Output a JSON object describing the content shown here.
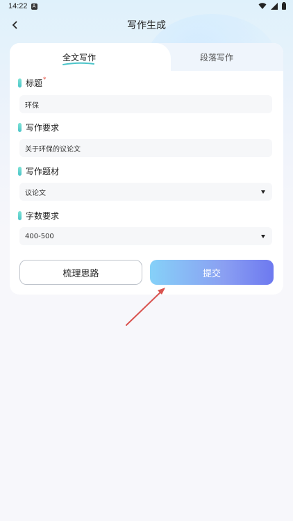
{
  "status": {
    "time": "14:22",
    "badge": "A"
  },
  "header": {
    "title": "写作生成"
  },
  "tabs": [
    {
      "label": "全文写作",
      "active": true
    },
    {
      "label": "段落写作",
      "active": false
    }
  ],
  "fields": {
    "title": {
      "label": "标题",
      "required_mark": "*",
      "value": "环保"
    },
    "requirement": {
      "label": "写作要求",
      "value": "关于环保的议论文"
    },
    "genre": {
      "label": "写作题材",
      "value": "议论文"
    },
    "word_count": {
      "label": "字数要求",
      "value": "400-500"
    }
  },
  "buttons": {
    "outline": "梳理思路",
    "primary": "提交"
  },
  "colors": {
    "accent_start": "#86d1f8",
    "accent_end": "#6d79f0",
    "annotation": "#d9534f",
    "marker": "#4bc4c9"
  }
}
